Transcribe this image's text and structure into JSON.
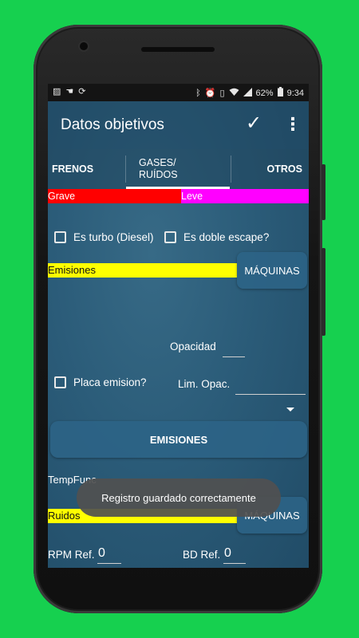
{
  "statusbar": {
    "battery": "62%",
    "time": "9:34",
    "left_icons": [
      "image-icon",
      "hand-icon",
      "sync-icon"
    ],
    "right_icons": [
      "bluetooth-icon",
      "alarm-icon",
      "vibrate-icon",
      "wifi-icon",
      "signal-icon",
      "battery-icon"
    ]
  },
  "appbar": {
    "title": "Datos objetivos"
  },
  "tabs": [
    {
      "label": "FRENOS"
    },
    {
      "label_line1": "GASES/",
      "label_line2": "RUÍDOS"
    },
    {
      "label": "OTROS"
    }
  ],
  "severity": {
    "grave": "Grave",
    "leve": "Leve",
    "grave_color": "#ff0000",
    "leve_color": "#ff00ff"
  },
  "checkboxes": {
    "turbo": "Es turbo (Diesel)",
    "doble_escape": "Es doble escape?",
    "placa_emision": "Placa emision?"
  },
  "emisiones_section": {
    "header": "Emisiones",
    "maquinas_button": "MÁQUINAS",
    "opacidad_label": "Opacidad",
    "lim_opac_label": "Lim. Opac.",
    "emisiones_button": "EMISIONES"
  },
  "ruidos_section": {
    "temp_label": "TempFunc",
    "header": "Ruidos",
    "maquinas_button": "MÁQUINAS",
    "rpm_label": "RPM Ref.",
    "rpm_value": "0",
    "bd_label": "BD Ref.",
    "bd_value": "0"
  },
  "toast": {
    "message": "Registro guardado correctamente"
  },
  "colors": {
    "highlight_yellow": "#ffff00",
    "background": "#16d04f"
  }
}
